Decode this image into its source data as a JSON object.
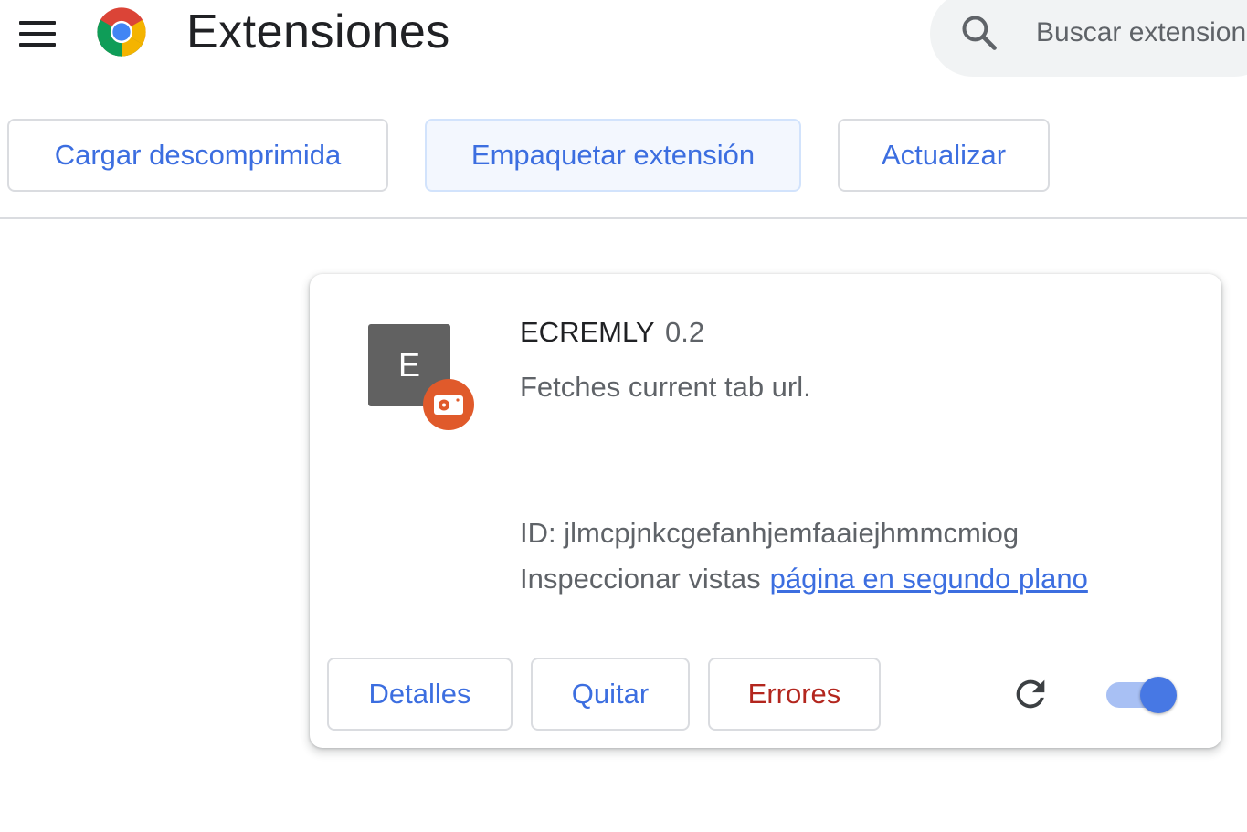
{
  "header": {
    "title": "Extensiones",
    "menu_icon": "hamburger-menu-icon",
    "logo_icon": "chrome-logo-icon",
    "search": {
      "placeholder": "Buscar extensiones",
      "icon": "search-icon"
    }
  },
  "toolbar": {
    "load_unpacked_label": "Cargar descomprimida",
    "pack_extension_label": "Empaquetar extensión",
    "update_label": "Actualizar"
  },
  "extension": {
    "icon_letter": "E",
    "badge_icon": "unpacked-extension-badge-icon",
    "name": "ECREMLY",
    "version": "0.2",
    "description": "Fetches current tab url.",
    "id_text": "ID: jlmcpjnkcgefanhjemfaaiejhmmcmiog",
    "inspect_label": "Inspeccionar vistas",
    "inspect_link": "página en segundo plano",
    "details_label": "Detalles",
    "remove_label": "Quitar",
    "errors_label": "Errores",
    "reload_icon": "reload-icon",
    "enabled": true
  },
  "colors": {
    "accent": "#3c6ee0",
    "error": "#b3261e",
    "badge": "#e05a2b",
    "toggle_on": "#4778e4"
  }
}
